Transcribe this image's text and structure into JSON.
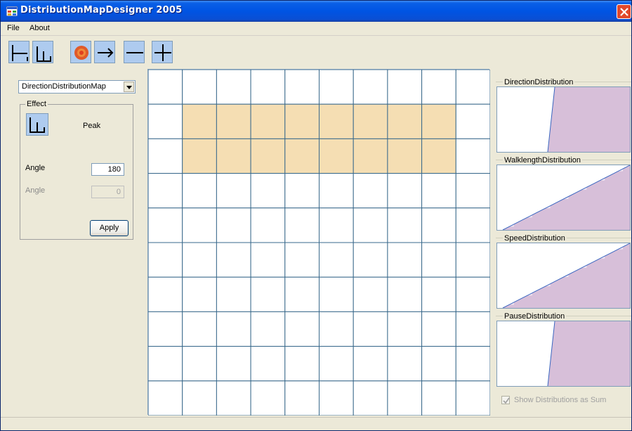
{
  "window": {
    "title": "DistributionMapDesigner 2005"
  },
  "menu": {
    "items": [
      "File",
      "About"
    ]
  },
  "toolbar": {
    "tools": [
      "wall-icon",
      "peak-icon",
      "source-icon",
      "arrow-right-icon",
      "horizontal-line-icon",
      "cross-icon"
    ]
  },
  "left_panel": {
    "map_select": {
      "value": "DirectionDistributionMap"
    },
    "effect": {
      "legend": "Effect",
      "type_label": "Peak",
      "angle1_label": "Angle",
      "angle1_value": "180",
      "angle2_label": "Angle",
      "angle2_value": "0",
      "apply_label": "Apply"
    }
  },
  "grid": {
    "rows": 10,
    "cols": 10,
    "highlighted_rows": [
      1,
      2
    ],
    "highlighted_cols": [
      1,
      2,
      3,
      4,
      5,
      6,
      7,
      8
    ],
    "highlight_color": "#f5deb3",
    "line_color": "#3a6a8c"
  },
  "distributions": [
    {
      "label": "DirectionDistribution",
      "kind": "step"
    },
    {
      "label": "WalklengthDistribution",
      "kind": "ramp"
    },
    {
      "label": "SpeedDistribution",
      "kind": "ramp"
    },
    {
      "label": "PauseDistribution",
      "kind": "step"
    }
  ],
  "fill_color": "#d7bfd9",
  "show_sum": {
    "label": "Show Distributions as Sum",
    "checked": true
  }
}
